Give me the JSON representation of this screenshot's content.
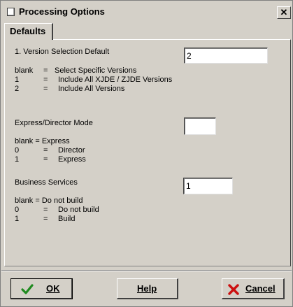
{
  "window": {
    "title": "Processing Options",
    "close_glyph": "✕"
  },
  "tabs": [
    {
      "label": "Defaults",
      "active": true
    }
  ],
  "options": [
    {
      "label": "1.  Version Selection Default",
      "value": "2",
      "choices": [
        {
          "key": "blank",
          "eq": "=",
          "text": "Select Specific Versions"
        },
        {
          "key": "1",
          "eq": "=",
          "text": "Include All XJDE / ZJDE Versions"
        },
        {
          "key": "2",
          "eq": "=",
          "text": "Include All Versions"
        }
      ]
    },
    {
      "label": "Express/Director Mode",
      "value": "",
      "choices": [
        {
          "key": "blank = Express",
          "eq": "",
          "text": ""
        },
        {
          "key": "0",
          "eq": "=",
          "text": "Director"
        },
        {
          "key": "1",
          "eq": "=",
          "text": "Express"
        }
      ]
    },
    {
      "label": "Business Services",
      "value": "1",
      "choices": [
        {
          "key": "blank = Do not build",
          "eq": "",
          "text": ""
        },
        {
          "key": "0",
          "eq": "=",
          "text": "Do not build"
        },
        {
          "key": "1",
          "eq": "=",
          "text": "Build"
        }
      ]
    }
  ],
  "buttons": {
    "ok": "OK",
    "help": "Help",
    "cancel": "Cancel"
  },
  "icons": {
    "ok": "checkmark-icon",
    "cancel": "red-x-icon",
    "title": "window-icon"
  },
  "colors": {
    "ok_icon": "#1f8a1f",
    "cancel_icon": "#cc1010",
    "face": "#d4d0c8"
  }
}
